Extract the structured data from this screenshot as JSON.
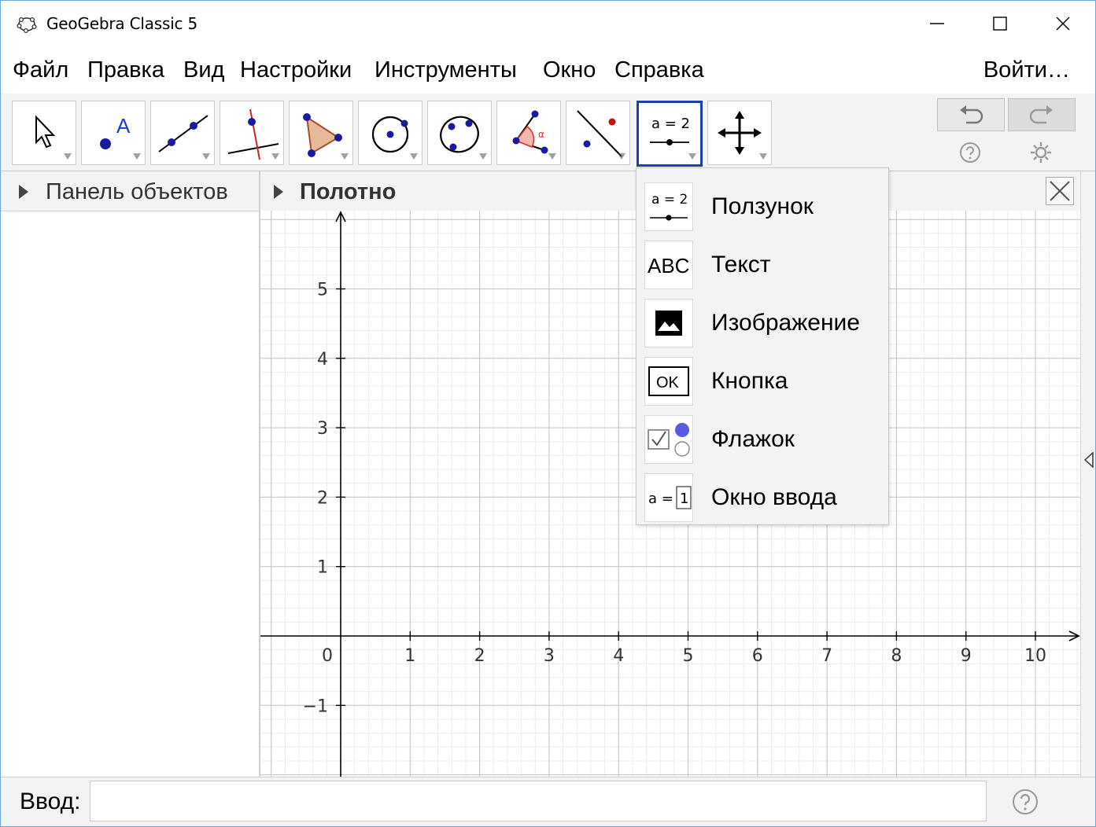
{
  "window": {
    "title": "GeoGebra Classic 5"
  },
  "menu": {
    "items": [
      "Файл",
      "Правка",
      "Вид",
      "Настройки",
      "Инструменты",
      "Окно",
      "Справка"
    ],
    "login": "Войти…"
  },
  "panels": {
    "algebra_title": "Панель объектов",
    "graphics_title": "Полотно"
  },
  "dropdown": {
    "items": [
      {
        "label": "Ползунок",
        "icon": "slider-icon"
      },
      {
        "label": "Текст",
        "icon": "text-icon"
      },
      {
        "label": "Изображение",
        "icon": "image-icon"
      },
      {
        "label": "Кнопка",
        "icon": "button-icon"
      },
      {
        "label": "Флажок",
        "icon": "checkbox-icon"
      },
      {
        "label": "Окно ввода",
        "icon": "input-box-icon"
      }
    ],
    "slider_icon_text": "a = 2",
    "text_icon_text": "ABC",
    "button_icon_text": "OK",
    "input_icon_text": "a =",
    "input_icon_value": "1"
  },
  "toolbar": {
    "tools": [
      "move-icon",
      "point-icon",
      "line-icon",
      "perpendicular-icon",
      "polygon-icon",
      "circle-icon",
      "conic-icon",
      "angle-icon",
      "reflect-icon",
      "slider-icon",
      "move-graphics-icon"
    ],
    "active_tool": "slider-icon",
    "slider_tool_text": "a = 2"
  },
  "graphics": {
    "x_ticks": [
      "0",
      "1",
      "2",
      "3",
      "4",
      "5",
      "6",
      "7",
      "8",
      "9",
      "10"
    ],
    "y_ticks": [
      "5",
      "4",
      "3",
      "2",
      "1",
      "−1"
    ]
  },
  "input": {
    "label": "Ввод:",
    "value": ""
  }
}
